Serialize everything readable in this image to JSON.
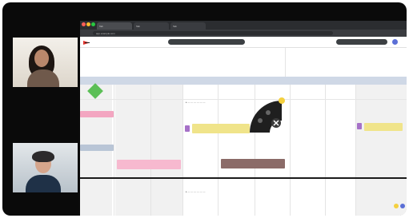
{
  "window": {
    "tabs": [
      {
        "label": "Tab"
      },
      {
        "label": "Tab"
      },
      {
        "label": "Tab"
      }
    ],
    "url": "app.example.com"
  },
  "toolbar": {
    "center_pill": "",
    "right_pill": ""
  },
  "columns": [
    "",
    "",
    "",
    "",
    "",
    "",
    "",
    "",
    ""
  ],
  "colors": {
    "accent_yellow": "#f0e48a",
    "pink": "#f3a6c1",
    "purple": "#a671c8",
    "green": "#5cbf57",
    "brown": "#8b6b68",
    "blue_card": "#b9c5d6",
    "dark_fan": "#1f1f1f"
  }
}
